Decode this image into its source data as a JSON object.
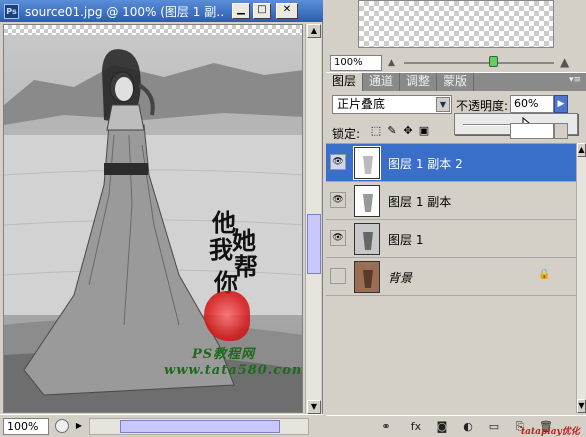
{
  "document_window": {
    "app_icon": "Ps",
    "title": "source01.jpg @ 100% (图层 1 副…",
    "buttons": {
      "minimize": "▁",
      "maximize": "□",
      "close": "✕"
    },
    "artwork": {
      "calligraphy": [
        "他",
        "她",
        "我",
        "帮",
        "你"
      ],
      "watermark_line1": "PS教程网",
      "watermark_line2": "www.tata580.com"
    },
    "status": {
      "zoom": "100%"
    }
  },
  "navigator": {
    "zoom": "100%",
    "small_mountain_icon": "small-mountain-icon",
    "big_mountain_icon": "big-mountain-icon"
  },
  "layers_panel": {
    "tabs": [
      "图层",
      "通道",
      "调整",
      "蒙版"
    ],
    "active_tab": 0,
    "blend_mode": "正片叠底",
    "opacity_label": "不透明度:",
    "opacity_value": "60%",
    "lock_label": "锁定:",
    "layers": [
      {
        "name": "图层 1 副本 2",
        "visible": true,
        "selected": true
      },
      {
        "name": "图层 1 副本",
        "visible": true,
        "selected": false
      },
      {
        "name": "图层 1",
        "visible": true,
        "selected": false
      },
      {
        "name": "背景",
        "visible": false,
        "selected": false,
        "locked": true
      }
    ],
    "footer_icons": [
      "link-icon",
      "fx-icon",
      "mask-icon",
      "adjustment-icon",
      "folder-icon",
      "new-layer-icon",
      "trash-icon"
    ]
  },
  "corner_watermark": "tataplay优化"
}
